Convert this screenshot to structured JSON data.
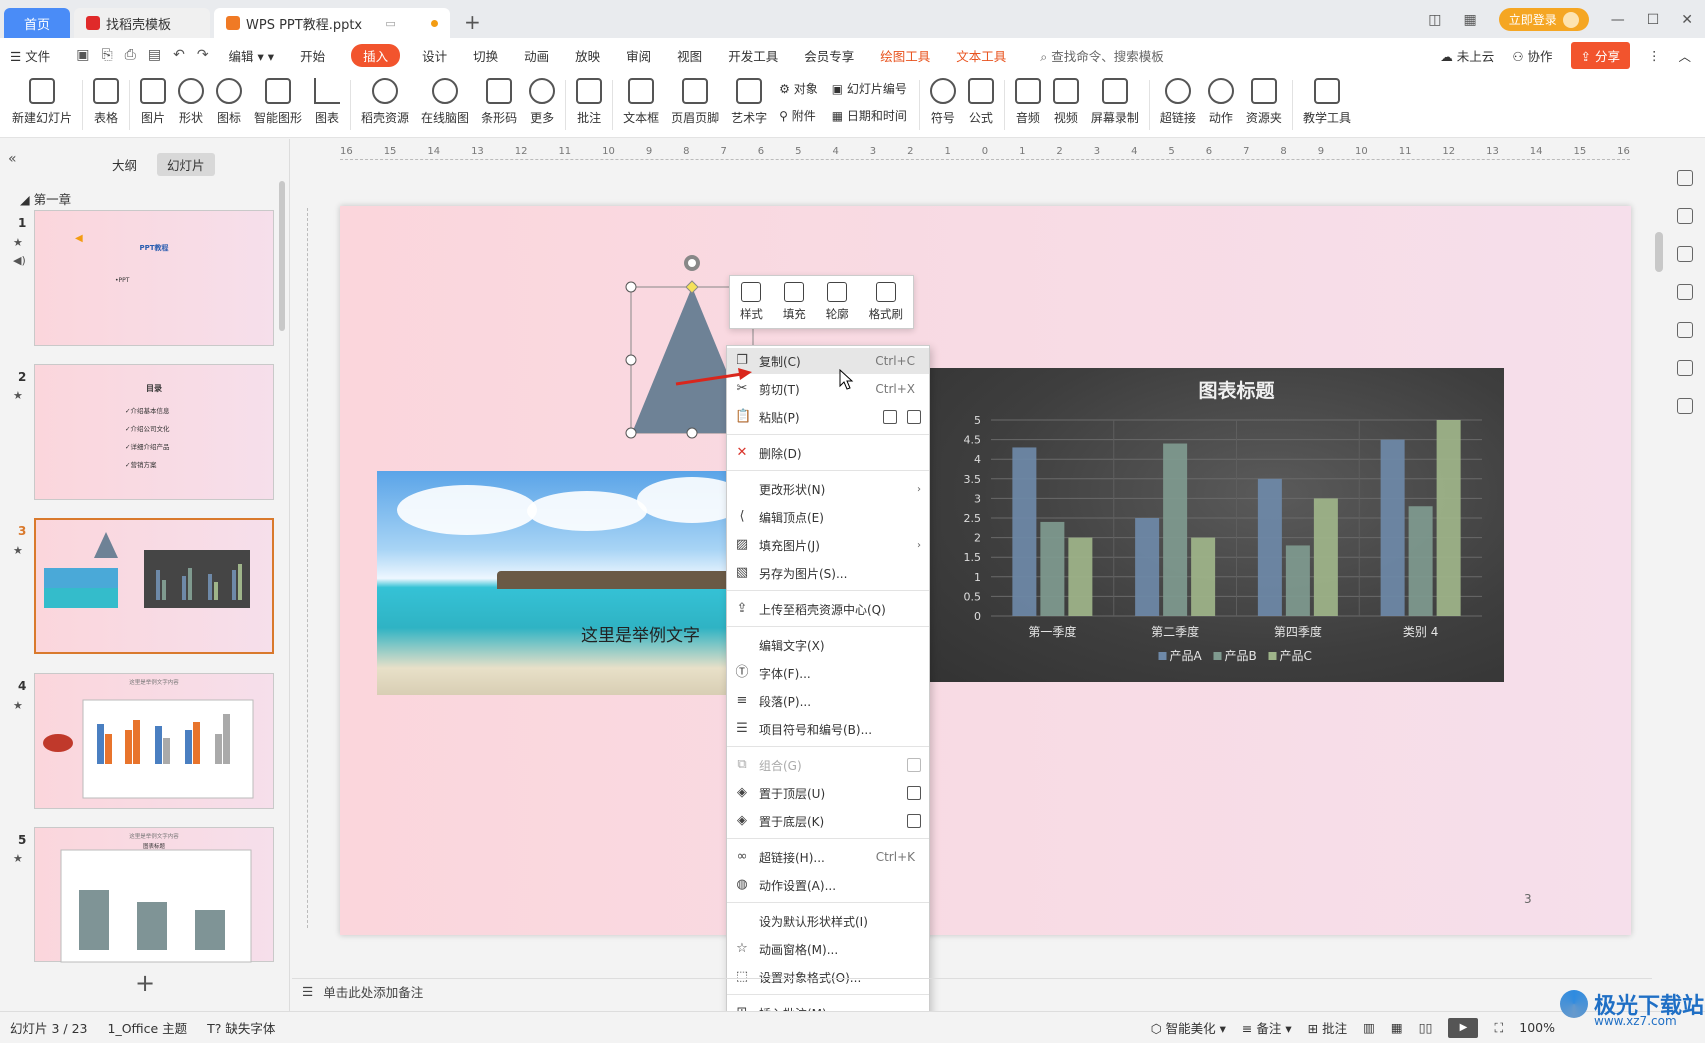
{
  "tabs": {
    "home": "首页",
    "template": "找稻壳模板",
    "document": "WPS PPT教程.pptx"
  },
  "titlebar": {
    "login": "立即登录"
  },
  "menu": {
    "file": "文件",
    "edit": "编辑",
    "items": [
      "开始",
      "插入",
      "设计",
      "切换",
      "动画",
      "放映",
      "审阅",
      "视图",
      "开发工具",
      "会员专享"
    ],
    "active": "插入",
    "chart_tools": "绘图工具",
    "text_tools": "文本工具",
    "search": "查找命令、搜索模板",
    "cloud": "未上云",
    "collab": "协作",
    "share": "分享"
  },
  "ribbon": {
    "new_slide": "新建幻灯片",
    "table": "表格",
    "picture": "图片",
    "shape": "形状",
    "icon": "图标",
    "smart_graphic": "智能图形",
    "chart": "图表",
    "docer_res": "稻壳资源",
    "mindmap": "在线脑图",
    "barcode": "条形码",
    "more": "更多",
    "comment": "批注",
    "textbox": "文本框",
    "header_footer": "页眉页脚",
    "wordart": "艺术字",
    "object": "对象",
    "attachment": "附件",
    "slide_number": "幻灯片编号",
    "date_time": "日期和时间",
    "symbol": "符号",
    "formula": "公式",
    "audio": "音频",
    "video": "视频",
    "screen_record": "屏幕录制",
    "hyperlink": "超链接",
    "action": "动作",
    "resource": "资源夹",
    "teaching": "教学工具"
  },
  "left_panel": {
    "outline_tab": "大纲",
    "slides_tab": "幻灯片",
    "chapter": "第一章",
    "thumbs": [
      {
        "num": "1",
        "title": "PPT教程",
        "sub": "•PPT"
      },
      {
        "num": "2",
        "title": "目录",
        "items": [
          "✓介绍基本信息",
          "✓介绍公司文化",
          "✓详细介绍产品",
          "✓营销方案"
        ]
      },
      {
        "num": "3"
      },
      {
        "num": "4",
        "title": "这里是举例文字内容"
      },
      {
        "num": "5",
        "title": "这里是举例文字内容",
        "chart_title": "图表标题"
      }
    ]
  },
  "slide": {
    "caption": "这里是举例文字",
    "page_number": "3"
  },
  "float_toolbar": {
    "style": "样式",
    "fill": "填充",
    "outline": "轮廓",
    "format_painter": "格式刷"
  },
  "context_menu": {
    "copy": "复制(C)",
    "copy_sc": "Ctrl+C",
    "cut": "剪切(T)",
    "cut_sc": "Ctrl+X",
    "paste": "粘贴(P)",
    "delete": "删除(D)",
    "change_shape": "更改形状(N)",
    "edit_points": "编辑顶点(E)",
    "fill_picture": "填充图片(J)",
    "save_as_picture": "另存为图片(S)...",
    "upload": "上传至稻壳资源中心(Q)",
    "edit_text": "编辑文字(X)",
    "font": "字体(F)...",
    "paragraph": "段落(P)...",
    "bullets": "项目符号和编号(B)...",
    "group": "组合(G)",
    "bring_front": "置于顶层(U)",
    "send_back": "置于底层(K)",
    "hyperlink": "超链接(H)...",
    "hyperlink_sc": "Ctrl+K",
    "action_settings": "动作设置(A)...",
    "set_default": "设为默认形状样式(I)",
    "animation_pane": "动画窗格(M)...",
    "format_object": "设置对象格式(O)...",
    "insert_comment": "插入批注(M)"
  },
  "notes": {
    "placeholder": "单击此处添加备注"
  },
  "status": {
    "slide_pos": "幻灯片 3 / 23",
    "theme": "1_Office 主题",
    "missing_font": "缺失字体",
    "beautify": "智能美化",
    "notes": "备注",
    "comment": "批注",
    "zoom": "100%"
  },
  "watermark": {
    "title": "极光下载站",
    "url": "www.xz7.com"
  },
  "colors": {
    "accent": "#f2542d",
    "series_a": "#6e89a8",
    "series_b": "#7f9a8f",
    "series_c": "#9fb58a"
  },
  "chart_data": {
    "type": "bar",
    "title": "图表标题",
    "categories": [
      "第一季度",
      "第二季度",
      "第四季度",
      "类别 4"
    ],
    "series": [
      {
        "name": "产品A",
        "values": [
          4.3,
          2.5,
          3.5,
          4.5
        ]
      },
      {
        "name": "产品B",
        "values": [
          2.4,
          4.4,
          1.8,
          2.8
        ]
      },
      {
        "name": "产品C",
        "values": [
          2.0,
          2.0,
          3.0,
          5.0
        ]
      }
    ],
    "ylim": [
      0,
      5
    ],
    "yticks": [
      "0",
      "0.5",
      "1",
      "1.5",
      "2",
      "2.5",
      "3",
      "3.5",
      "4",
      "4.5",
      "5"
    ],
    "grid": true,
    "legend": "bottom"
  }
}
